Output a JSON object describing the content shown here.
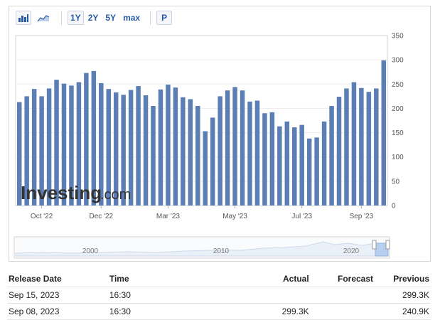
{
  "toolbar": {
    "bar_chart_icon": "bar-chart-icon",
    "area_chart_icon": "area-chart-icon",
    "ranges": [
      "1Y",
      "2Y",
      "5Y",
      "max"
    ],
    "p_label": "P"
  },
  "watermark": {
    "brand": "Investing",
    "suffix": ".com"
  },
  "chart_data": {
    "type": "bar",
    "color": "#5b7fb4",
    "ylim": [
      0,
      350
    ],
    "y_ticks": [
      0,
      50,
      100,
      150,
      200,
      250,
      300,
      350
    ],
    "x_tick_labels": [
      "Oct '22",
      "Dec '22",
      "Mar '23",
      "May '23",
      "Jul '23",
      "Sep '23"
    ],
    "x_tick_positions": [
      3,
      11,
      20,
      29,
      38,
      46
    ],
    "values": [
      213,
      225,
      240,
      225,
      241,
      259,
      251,
      247,
      254,
      273,
      277,
      252,
      240,
      233,
      228,
      238,
      246,
      227,
      205,
      239,
      249,
      243,
      223,
      219,
      205,
      153,
      181,
      225,
      237,
      244,
      237,
      214,
      216,
      190,
      192,
      163,
      173,
      161,
      166,
      138,
      140,
      173,
      205,
      224,
      241,
      254,
      242,
      234,
      241,
      299
    ]
  },
  "navigator": {
    "labels": [
      "2000",
      "2010",
      "2020"
    ]
  },
  "releases": {
    "headers": {
      "date": "Release Date",
      "time": "Time",
      "actual": "Actual",
      "forecast": "Forecast",
      "previous": "Previous"
    },
    "rows": [
      {
        "date": "Sep 15, 2023",
        "time": "16:30",
        "actual": "",
        "forecast": "",
        "previous": "299.3K"
      },
      {
        "date": "Sep 08, 2023",
        "time": "16:30",
        "actual": "299.3K",
        "forecast": "",
        "previous": "240.9K"
      }
    ]
  }
}
